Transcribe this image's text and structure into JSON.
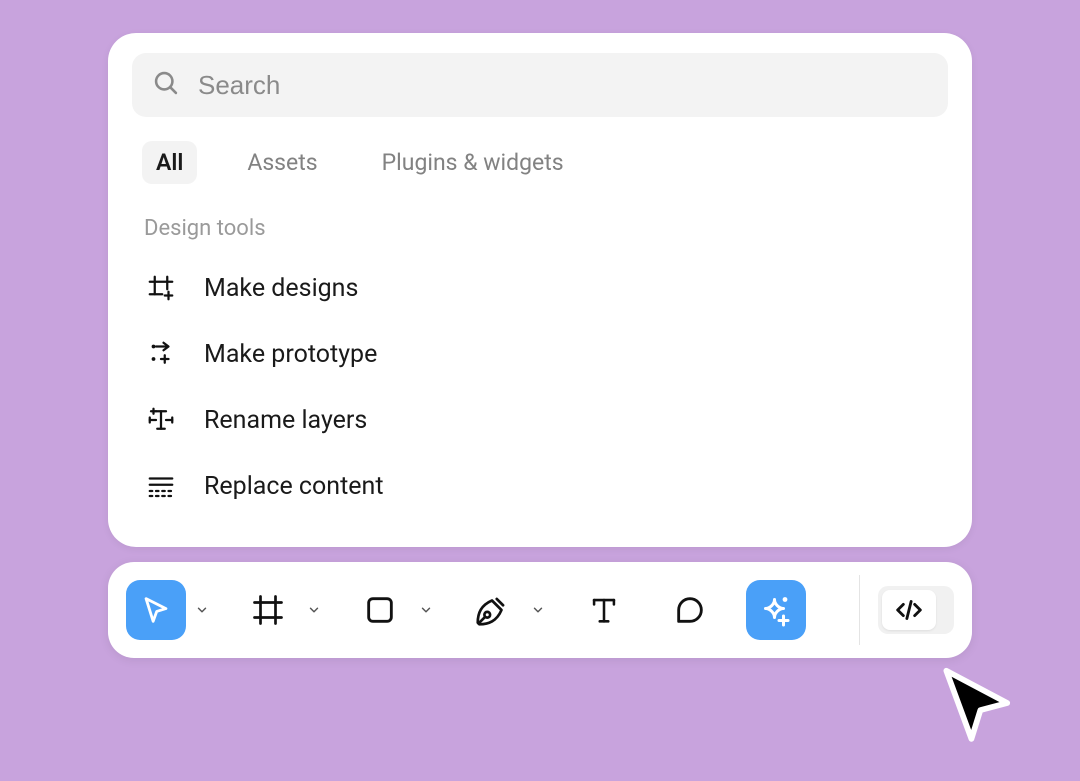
{
  "search": {
    "placeholder": "Search"
  },
  "tabs": [
    {
      "label": "All",
      "active": true
    },
    {
      "label": "Assets",
      "active": false
    },
    {
      "label": "Plugins & widgets",
      "active": false
    }
  ],
  "section": {
    "header": "Design tools"
  },
  "items": [
    {
      "label": "Make designs",
      "icon": "frame-plus-icon"
    },
    {
      "label": "Make prototype",
      "icon": "prototype-icon"
    },
    {
      "label": "Rename layers",
      "icon": "rename-icon"
    },
    {
      "label": "Replace content",
      "icon": "replace-content-icon"
    }
  ],
  "toolbar": {
    "tools": [
      {
        "name": "move-tool",
        "active": true,
        "hasChevron": true
      },
      {
        "name": "frame-tool",
        "active": false,
        "hasChevron": true
      },
      {
        "name": "shape-tool",
        "active": false,
        "hasChevron": true
      },
      {
        "name": "pen-tool",
        "active": false,
        "hasChevron": true
      },
      {
        "name": "text-tool",
        "active": false,
        "hasChevron": false
      },
      {
        "name": "comment-tool",
        "active": false,
        "hasChevron": false
      },
      {
        "name": "ai-tool",
        "active": true,
        "hasChevron": false
      }
    ],
    "devmode": {
      "name": "dev-mode-toggle"
    }
  }
}
